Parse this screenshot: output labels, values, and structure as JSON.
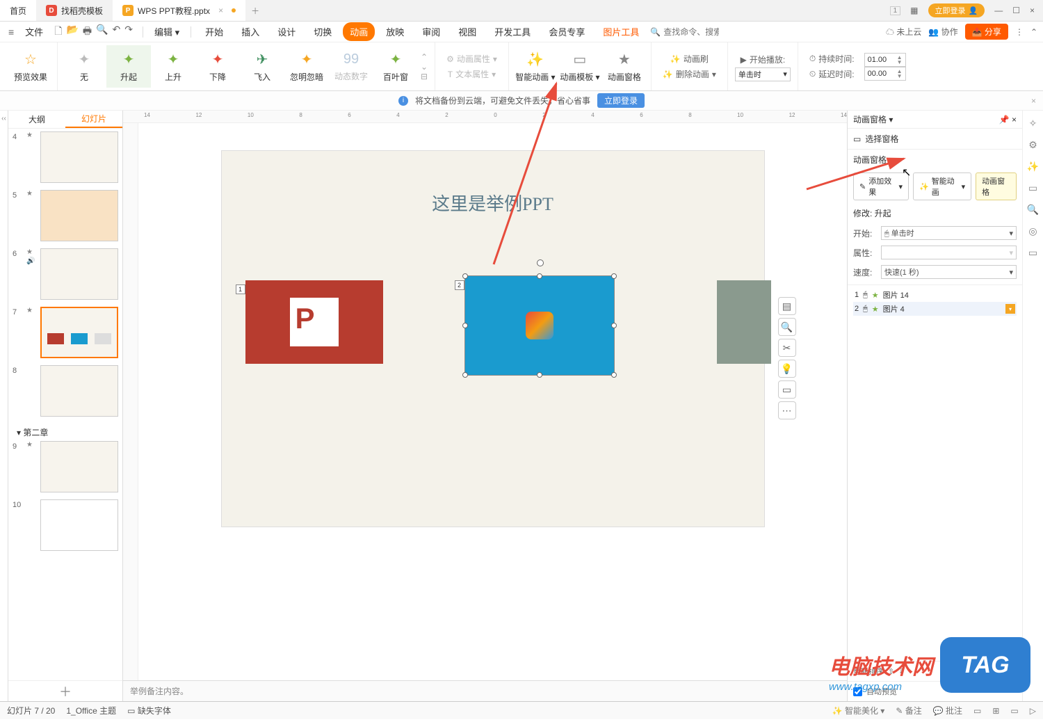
{
  "titlebar": {
    "home": "首页",
    "template": "找稻壳模板",
    "doc": "WPS PPT教程.pptx",
    "close_glyph": "×",
    "add_glyph": "＋",
    "badge1": "1",
    "login": "立即登录",
    "win_min": "—",
    "win_max": "☐",
    "win_close": "×"
  },
  "menubar": {
    "file": "文件",
    "edit": "编辑",
    "items": [
      "开始",
      "插入",
      "设计",
      "切换",
      "动画",
      "放映",
      "审阅",
      "视图",
      "开发工具",
      "会员专享"
    ],
    "active_index": 4,
    "pic_tools": "图片工具",
    "search_icon": "🔍",
    "search_ph": "查找命令、搜索模板",
    "cloud": "未上云",
    "coop": "协作",
    "share": "分享",
    "more": "⋮"
  },
  "ribbon": {
    "preview": "预览效果",
    "effects": [
      {
        "label": "无",
        "color": "#bbb"
      },
      {
        "label": "升起",
        "color": "#7cb342"
      },
      {
        "label": "上升",
        "color": "#7cb342"
      },
      {
        "label": "下降",
        "color": "#e74c3c"
      },
      {
        "label": "飞入",
        "color": "#3f8f5f"
      },
      {
        "label": "忽明忽暗",
        "color": "#f5a623"
      },
      {
        "label": "动态数字",
        "color": "#bcd"
      },
      {
        "label": "百叶窗",
        "color": "#7cb342"
      }
    ],
    "selected_effect_index": 1,
    "anim_props": "动画属性",
    "text_props": "文本属性",
    "smart_anim": "智能动画",
    "anim_template": "动画模板",
    "anim_pane": "动画窗格",
    "anim_brush": "动画刷",
    "delete_anim": "删除动画",
    "start_play": "开始播放:",
    "start_val": "单击时",
    "duration": "持续时间:",
    "duration_val": "01.00",
    "delay": "延迟时间:",
    "delay_val": "00.00"
  },
  "notice": {
    "text": "将文档备份到云端，可避免文件丢失，省心省事",
    "login": "立即登录",
    "close": "×"
  },
  "slidepanel": {
    "tab_outline": "大纲",
    "tab_slides": "幻灯片",
    "section2": "第二章",
    "add": "＋",
    "thumbs": [
      {
        "num": "4"
      },
      {
        "num": "5"
      },
      {
        "num": "6"
      },
      {
        "num": "7",
        "selected": true
      },
      {
        "num": "8"
      }
    ],
    "thumbs2": [
      {
        "num": "9"
      },
      {
        "num": "10"
      }
    ]
  },
  "slide": {
    "title": "这里是举例PPT",
    "tag1": "1",
    "tag2": "2"
  },
  "notes": {
    "placeholder": "举例备注内容。"
  },
  "rightpane": {
    "head": "动画窗格",
    "pin": "📌",
    "close": "×",
    "select_pane": "选择窗格",
    "section": "动画窗格",
    "add_effect": "添加效果",
    "smart_anim": "智能动画",
    "anim_pane_btn": "动画窗格",
    "modify_label": "修改: 升起",
    "start_label": "开始:",
    "start_val": "单击时",
    "prop_label": "属性:",
    "prop_val": "",
    "speed_label": "速度:",
    "speed_val": "快速(1 秒)",
    "effects": [
      {
        "idx": "1",
        "name": "图片 14"
      },
      {
        "idx": "2",
        "name": "图片 4"
      }
    ],
    "reorder": "重新排序",
    "auto_preview": "自动预览"
  },
  "statusbar": {
    "slide_info": "幻灯片 7 / 20",
    "theme": "1_Office 主题",
    "missing_font": "缺失字体",
    "beautify": "智能美化",
    "notes": "备注",
    "approve": "批注"
  },
  "watermark": {
    "text": "电脑技术网",
    "url": "www.tagxp.com",
    "tag": "TAG"
  }
}
